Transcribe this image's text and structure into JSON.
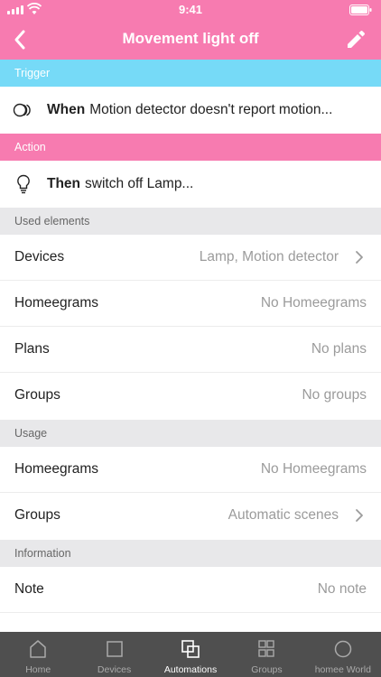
{
  "status_bar": {
    "time": "9:41"
  },
  "header": {
    "title": "Movement light off"
  },
  "trigger": {
    "section_label": "Trigger",
    "keyword": "When",
    "text": "Motion detector doesn't report motion..."
  },
  "action": {
    "section_label": "Action",
    "keyword": "Then",
    "text": "switch off Lamp..."
  },
  "used_elements": {
    "section_label": "Used elements",
    "rows": [
      {
        "label": "Devices",
        "value": "Lamp, Motion detector"
      },
      {
        "label": "Homeegrams",
        "value": "No Homeegrams"
      },
      {
        "label": "Plans",
        "value": "No plans"
      },
      {
        "label": "Groups",
        "value": "No groups"
      }
    ]
  },
  "usage": {
    "section_label": "Usage",
    "rows": [
      {
        "label": "Homeegrams",
        "value": "No Homeegrams"
      },
      {
        "label": "Groups",
        "value": "Automatic scenes"
      }
    ]
  },
  "information": {
    "section_label": "Information",
    "rows": [
      {
        "label": "Note",
        "value": "No note"
      }
    ]
  },
  "tab_bar": {
    "tabs": [
      {
        "label": "Home",
        "icon": "house-icon"
      },
      {
        "label": "Devices",
        "icon": "square-icon"
      },
      {
        "label": "Automations",
        "icon": "overlapping-squares-icon",
        "active": true
      },
      {
        "label": "Groups",
        "icon": "grid-squares-icon"
      },
      {
        "label": "homee World",
        "icon": "circle-icon"
      }
    ]
  },
  "colors": {
    "header": "#f77bb0",
    "trigger": "#76daf7",
    "action": "#f77bb0",
    "tab_bar": "#4f4f4f"
  }
}
